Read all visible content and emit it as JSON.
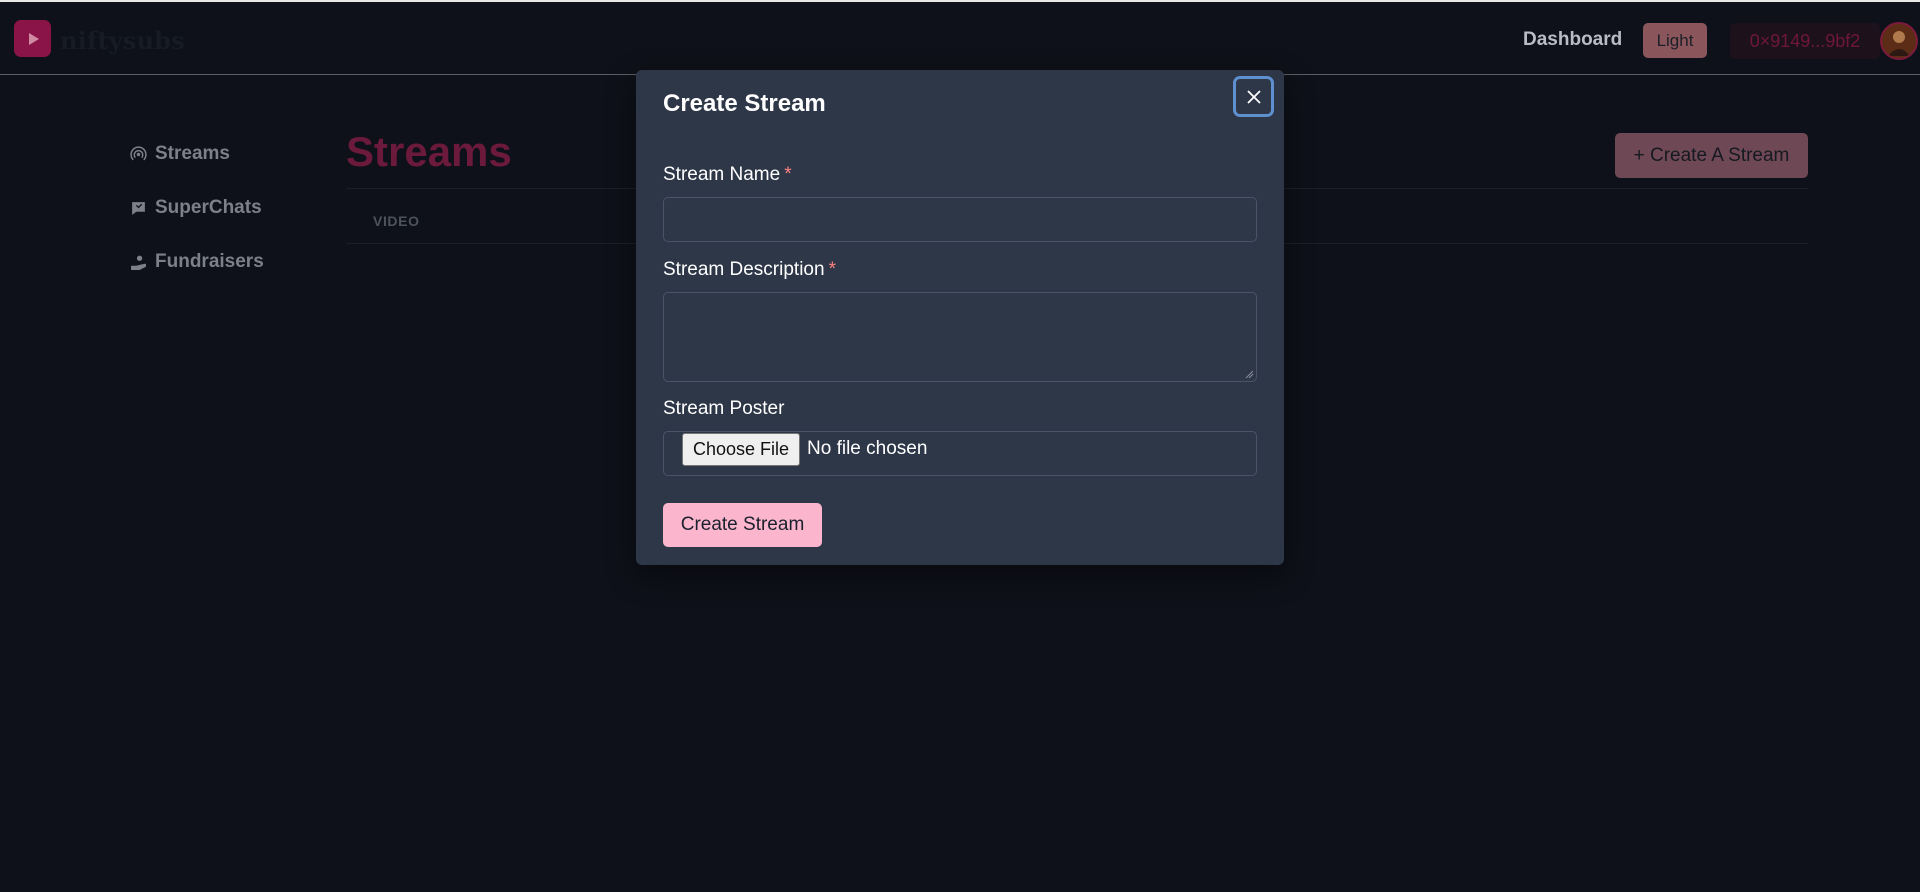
{
  "nav": {
    "brand": "niftysubs",
    "dashboard_label": "Dashboard",
    "theme_label": "Light",
    "wallet_address": "0×9149...9bf2"
  },
  "sidebar": {
    "items": [
      {
        "label": "Streams",
        "icon": "broadcast-icon"
      },
      {
        "label": "SuperChats",
        "icon": "chat-icon"
      },
      {
        "label": "Fundraisers",
        "icon": "hand-heart-icon"
      }
    ]
  },
  "main": {
    "title": "Streams",
    "create_button": "+ Create A Stream",
    "table_header": "VIDEO"
  },
  "modal": {
    "title": "Create Stream",
    "fields": {
      "name": {
        "label": "Stream Name",
        "required_mark": "*",
        "value": ""
      },
      "description": {
        "label": "Stream Description",
        "required_mark": "*",
        "value": ""
      },
      "poster": {
        "label": "Stream Poster",
        "choose_label": "Choose File",
        "status": "No file chosen"
      }
    },
    "submit_label": "Create Stream"
  },
  "colors": {
    "brand": "#8a1447",
    "page_bg": "#0e1119",
    "modal_bg": "#2e3748",
    "submit_bg": "#fbb6ce",
    "required": "#fc8181",
    "focus_ring": "#5e8fcf"
  }
}
